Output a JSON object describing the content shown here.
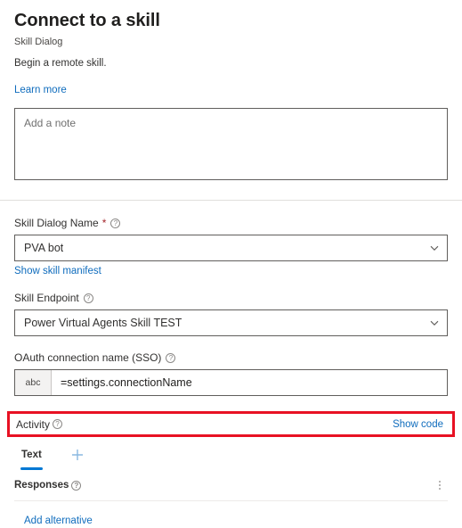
{
  "header": {
    "title": "Connect to a skill",
    "subtitle": "Skill Dialog",
    "description": "Begin a remote skill.",
    "learn_more_label": "Learn more"
  },
  "note": {
    "placeholder": "Add a note",
    "value": ""
  },
  "fields": {
    "skill_dialog_name": {
      "label": "Skill Dialog Name",
      "required_marker": "*",
      "info_icon": "help-circle-icon",
      "value": "PVA bot",
      "chevron_icon": "chevron-down-icon",
      "sublink_label": "Show skill manifest"
    },
    "skill_endpoint": {
      "label": "Skill Endpoint",
      "info_icon": "help-circle-icon",
      "value": "Power Virtual Agents Skill TEST",
      "chevron_icon": "chevron-down-icon"
    },
    "oauth_connection": {
      "label": "OAuth connection name (SSO)",
      "info_icon": "help-circle-icon",
      "type_badge": "abc",
      "value": "=settings.connectionName"
    }
  },
  "activity": {
    "label": "Activity",
    "info_icon": "help-circle-icon",
    "show_code_label": "Show code",
    "highlight_color": "#e81123"
  },
  "tabs": {
    "items": [
      {
        "label": "Text",
        "selected": true
      }
    ],
    "add_icon": "plus-icon",
    "accent_color": "#0078d4"
  },
  "responses": {
    "label": "Responses",
    "info_icon": "help-circle-icon",
    "menu_icon": "more-vertical-icon",
    "add_alternative_label": "Add alternative"
  },
  "colors": {
    "link": "#0f6cbd",
    "accent": "#0078d4",
    "required": "#a4262c",
    "highlight": "#e81123",
    "border": "#605e5c",
    "text": "#323130"
  }
}
